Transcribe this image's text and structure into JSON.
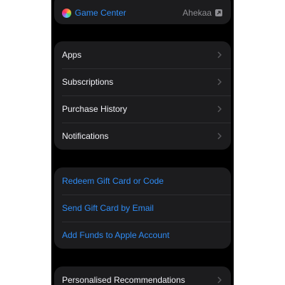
{
  "game_center": {
    "label": "Game Center",
    "value": "Ahekaa"
  },
  "account_group": {
    "items": [
      {
        "label": "Apps"
      },
      {
        "label": "Subscriptions"
      },
      {
        "label": "Purchase History"
      },
      {
        "label": "Notifications"
      }
    ]
  },
  "gift_group": {
    "items": [
      {
        "label": "Redeem Gift Card or Code"
      },
      {
        "label": "Send Gift Card by Email"
      },
      {
        "label": "Add Funds to Apple Account"
      }
    ]
  },
  "recommendations_group": {
    "items": [
      {
        "label": "Personalised Recommendations"
      }
    ]
  },
  "colors": {
    "background": "#000000",
    "cell": "#1c1c1e",
    "link": "#2f8cf5",
    "text": "#f2f2f7",
    "secondary": "#8e8e93"
  }
}
